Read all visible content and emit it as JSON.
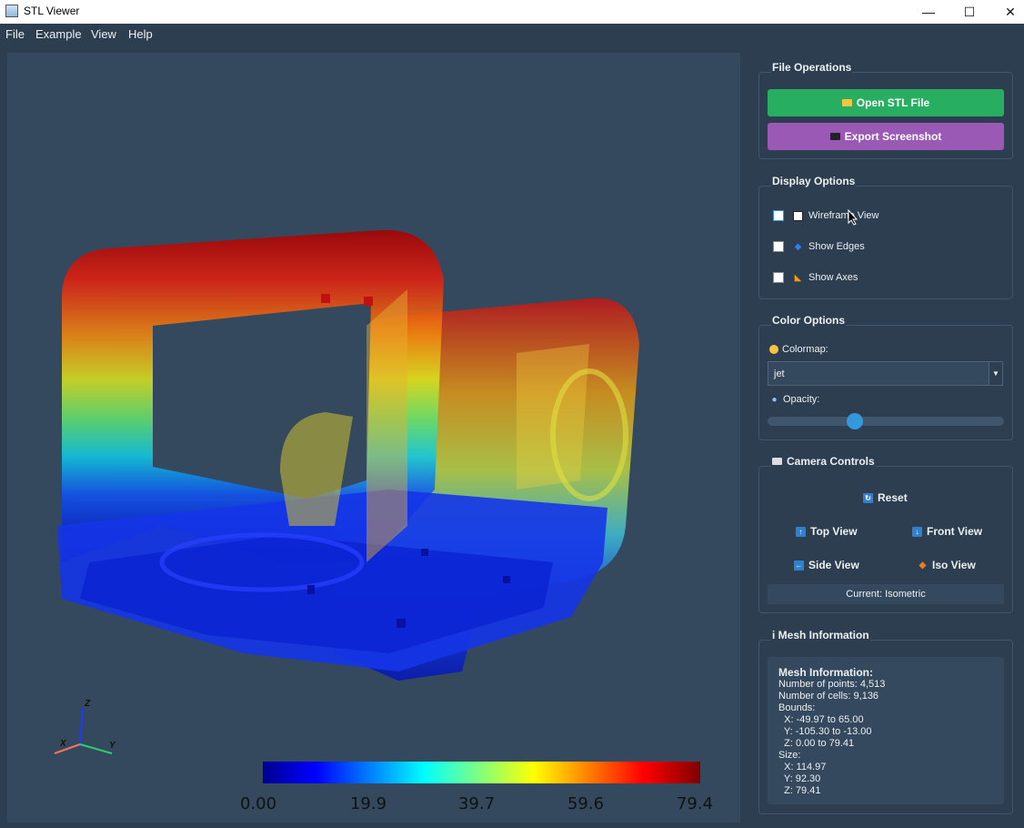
{
  "window": {
    "title": "STL Viewer",
    "minimize": "—",
    "maximize": "☐",
    "close": "✕"
  },
  "menu": [
    "File",
    "Example",
    "View",
    "Help"
  ],
  "file_operations": {
    "title": "File Operations",
    "open_button": "Open STL File",
    "export_button": "Export Screenshot",
    "open_color": "#27ae60",
    "export_color": "#9b59b6"
  },
  "display_options": {
    "title": "Display Options",
    "items": [
      {
        "label": "Wireframe View",
        "checked": false,
        "icon": "square-icon"
      },
      {
        "label": "Show Edges",
        "checked": false,
        "icon": "diamond-icon"
      },
      {
        "label": "Show Axes",
        "checked": false,
        "icon": "triangle-ruler-icon"
      }
    ]
  },
  "color_options": {
    "title": "Color Options",
    "colormap_label": "Colormap:",
    "colormap_value": "jet",
    "opacity_label": "Opacity:",
    "opacity_value": 0.37
  },
  "camera_controls": {
    "title": "Camera Controls",
    "reset": "Reset",
    "top_view": "Top View",
    "front_view": "Front View",
    "side_view": "Side View",
    "iso_view": "Iso View",
    "current": "Current: Isometric"
  },
  "mesh_info": {
    "title": "i Mesh Information",
    "heading": "Mesh Information:",
    "lines": [
      "Number of points: 4,513",
      "Number of cells: 9,136",
      "Bounds:",
      "  X: -49.97 to 65.00",
      "  Y: -105.30 to -13.00",
      "  Z: 0.00 to 79.41",
      "Size:",
      "  X: 114.97",
      "  Y: 92.30",
      "  Z: 79.41"
    ]
  },
  "colorbar": {
    "labels": [
      "0.00",
      "19.9",
      "39.7",
      "59.6",
      "79.4"
    ]
  },
  "axes_widget": {
    "x": "X",
    "y": "Y",
    "z": "Z"
  },
  "colors": {
    "background": "#2c3e50",
    "viewport": "#34495e",
    "accent": "#3498db"
  }
}
